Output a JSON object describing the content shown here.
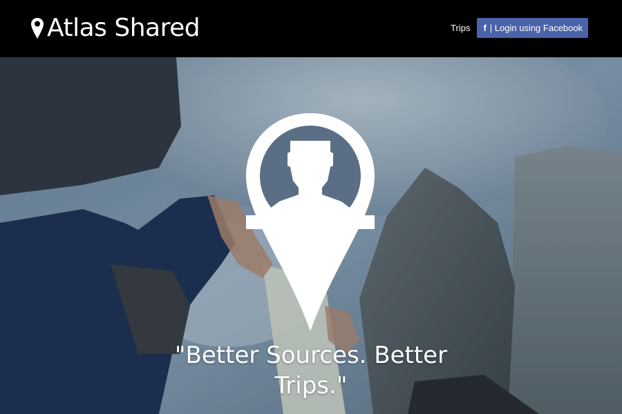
{
  "navbar": {
    "brand": "Atlas Shared",
    "brand_icon": "map-pin-icon",
    "links": {
      "trips": "Trips"
    },
    "facebook_button": {
      "icon": "f",
      "label": "| Login using Facebook",
      "color": "#4b63a8"
    }
  },
  "hero": {
    "logo_icon": "map-pin-person-icon",
    "tagline": "\"Better Sources. Better Trips.\""
  }
}
